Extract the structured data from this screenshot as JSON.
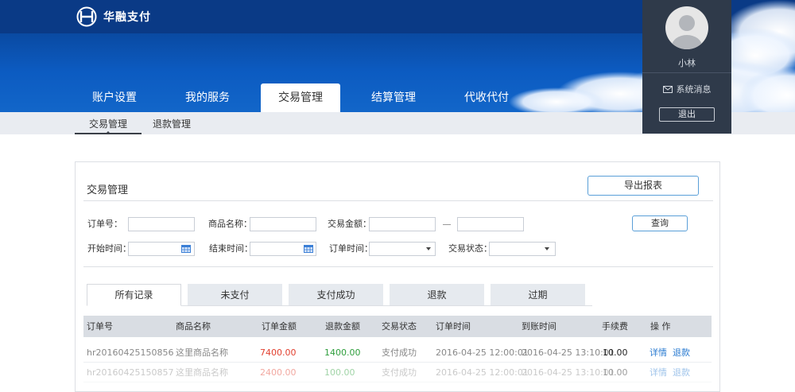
{
  "brand": {
    "name": "华融支付"
  },
  "nav": {
    "tabs": [
      {
        "label": "账户设置",
        "active": false
      },
      {
        "label": "我的服务",
        "active": false
      },
      {
        "label": "交易管理",
        "active": true
      },
      {
        "label": "结算管理",
        "active": false
      },
      {
        "label": "代收代付",
        "active": false
      }
    ]
  },
  "user": {
    "name": "小林",
    "messages_label": "系统消息",
    "logout_label": "退出"
  },
  "subnav": {
    "tabs": [
      {
        "label": "交易管理",
        "active": true
      },
      {
        "label": "退款管理",
        "active": false
      }
    ]
  },
  "panel": {
    "title": "交易管理",
    "export_label": "导出报表",
    "query_label": "查询"
  },
  "filters": {
    "order_no_label": "订单号：",
    "product_name_label": "商品名称：",
    "amount_label": "交易金额：",
    "start_time_label": "开始时间：",
    "end_time_label": "结束时间：",
    "order_time_label": "订单时间：",
    "status_label": "交易状态："
  },
  "record_tabs": [
    {
      "label": "所有记录",
      "active": true
    },
    {
      "label": "未支付",
      "active": false
    },
    {
      "label": "支付成功",
      "active": false
    },
    {
      "label": "退款",
      "active": false
    },
    {
      "label": "过期",
      "active": false
    }
  ],
  "table": {
    "columns": [
      "订单号",
      "商品名称",
      "订单金额",
      "退款金额",
      "交易状态",
      "订单时间",
      "到账时间",
      "手续费",
      "操 作"
    ],
    "rows": [
      {
        "order_no": "hr20160425150856",
        "product": "这里商品名称",
        "amount": "7400.00",
        "refund": "1400.00",
        "status": "支付成功",
        "order_time": "2016-04-25 12:00:01",
        "arrive_time": "2016-04-25 13:10:01",
        "fee": "10.00",
        "detail": "详情",
        "refund_action": "退款"
      },
      {
        "order_no": "hr20160425150857",
        "product": "这里商品名称",
        "amount": "2400.00",
        "refund": "100.00",
        "status": "支付成功",
        "order_time": "2016-04-25 12:00:01",
        "arrive_time": "2016-04-25 13:10:01",
        "fee": "10.00",
        "detail": "详情",
        "refund_action": "退款"
      }
    ]
  },
  "colors": {
    "header_blue": "#0a4aa2",
    "user_panel": "#2f3a4a",
    "accent_border": "#5a9fd8",
    "amount_red": "#e2402f",
    "refund_green": "#2e9e3c",
    "link_blue": "#2a7bd1"
  }
}
